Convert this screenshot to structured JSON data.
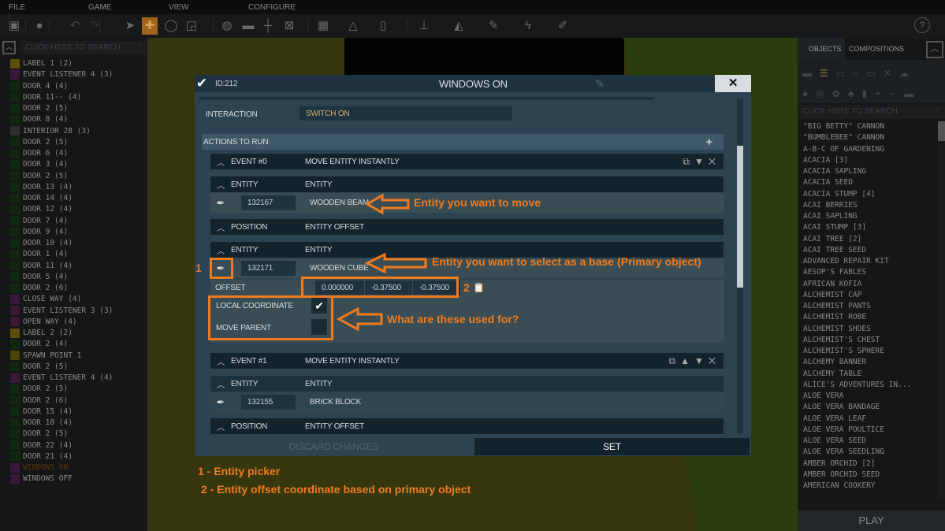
{
  "menubar": [
    "FILE",
    "GAME",
    "VIEW",
    "CONFIGURE"
  ],
  "left_panel": {
    "search_placeholder": "CLICK HERE TO SEARCH",
    "items": [
      {
        "label": "LABEL 1 (2)",
        "color": "#5a5008"
      },
      {
        "label": "EVENT LISTENER 4 (3)",
        "color": "#3a1838"
      },
      {
        "label": "DOOR 4 (4)",
        "color": "#10280f"
      },
      {
        "label": "DOOR 11-- (4)",
        "color": "#10280f"
      },
      {
        "label": "DOOR 2 (5)",
        "color": "#10280f"
      },
      {
        "label": "DOOR 8 (4)",
        "color": "#10280f"
      },
      {
        "label": "INTERIOR 28 (3)",
        "color": "#2e2e2e"
      },
      {
        "label": "DOOR 2 (5)",
        "color": "#10280f"
      },
      {
        "label": "DOOR 6 (4)",
        "color": "#10280f"
      },
      {
        "label": "DOOR 3 (4)",
        "color": "#10280f"
      },
      {
        "label": "DOOR 2 (5)",
        "color": "#10280f"
      },
      {
        "label": "DOOR 13 (4)",
        "color": "#10280f"
      },
      {
        "label": "DOOR 14 (4)",
        "color": "#10280f"
      },
      {
        "label": "DOOR 12 (4)",
        "color": "#10280f"
      },
      {
        "label": "DOOR 7 (4)",
        "color": "#10280f"
      },
      {
        "label": "DOOR 9 (4)",
        "color": "#10280f"
      },
      {
        "label": "DOOR 10 (4)",
        "color": "#10280f"
      },
      {
        "label": "DOOR 1 (4)",
        "color": "#10280f"
      },
      {
        "label": "DOOR 11 (4)",
        "color": "#10280f"
      },
      {
        "label": "DOOR 5 (4)",
        "color": "#10280f"
      },
      {
        "label": "DOOR 2 (6)",
        "color": "#10280f"
      },
      {
        "label": "CLOSE WAY (4)",
        "color": "#3a1838"
      },
      {
        "label": "EVENT LISTENER 3 (3)",
        "color": "#3a1838"
      },
      {
        "label": "OPEN WAY (4)",
        "color": "#3a1838"
      },
      {
        "label": "LABEL 2 (2)",
        "color": "#5a5008"
      },
      {
        "label": "DOOR 2 (4)",
        "color": "#10280f"
      },
      {
        "label": "SPAWN POINT 1",
        "color": "#4a4408"
      },
      {
        "label": "DOOR 2 (5)",
        "color": "#10280f"
      },
      {
        "label": "EVENT LISTENER 4 (4)",
        "color": "#3a1838"
      },
      {
        "label": "DOOR 2 (5)",
        "color": "#10280f"
      },
      {
        "label": "DOOR 2 (6)",
        "color": "#10280f"
      },
      {
        "label": "DOOR 15 (4)",
        "color": "#10280f"
      },
      {
        "label": "DOOR 18 (4)",
        "color": "#10280f"
      },
      {
        "label": "DOOR 2 (5)",
        "color": "#10280f"
      },
      {
        "label": "DOOR 22 (4)",
        "color": "#10280f"
      },
      {
        "label": "DOOR 21 (4)",
        "color": "#10280f"
      },
      {
        "label": "WINDOWS ON",
        "color": "#3a1838",
        "selected": true
      },
      {
        "label": "WINDOWS OFF",
        "color": "#3a1838"
      }
    ]
  },
  "right_panel": {
    "tabs": [
      "OBJECTS",
      "COMPOSITIONS"
    ],
    "search_placeholder": "CLICK HERE TO SEARCH",
    "items": [
      "\"BIG BETTY\" CANNON",
      "\"BUMBLEBEE\" CANNON",
      "A-B-C OF GARDENING",
      "ACACIA [3]",
      "ACACIA SAPLING",
      "ACACIA SEED",
      "ACACIA STUMP [4]",
      "ACAI BERRIES",
      "ACAI SAPLING",
      "ACAI STUMP [3]",
      "ACAI TREE [2]",
      "ACAI TREE SEED",
      "ADVANCED REPAIR KIT",
      "AESOP'S FABLES",
      "AFRICAN KOFIA",
      "ALCHEMIST CAP",
      "ALCHEMIST PANTS",
      "ALCHEMIST ROBE",
      "ALCHEMIST SHOES",
      "ALCHEMIST'S CHEST",
      "ALCHEMIST'S SPHERE",
      "ALCHEMY BANNER",
      "ALCHEMY TABLE",
      "ALICE'S ADVENTURES IN...",
      "ALOE VERA",
      "ALOE VERA BANDAGE",
      "ALOE VERA LEAF",
      "ALOE VERA POULTICE",
      "ALOE VERA SEED",
      "ALOE VERA SEEDLING",
      "AMBER ORCHID [2]",
      "AMBER ORCHID SEED",
      "AMERICAN COOKERY"
    ],
    "play_label": "PLAY"
  },
  "dialog": {
    "id": "ID:212",
    "title": "WINDOWS ON",
    "interaction_label": "INTERACTION",
    "interaction_value": "SWITCH ON",
    "actions_label": "ACTIONS TO RUN",
    "event0": {
      "label": "EVENT #0",
      "action": "MOVE ENTITY INSTANTLY",
      "entity_label": "ENTITY",
      "entity_type": "ENTITY",
      "entity_id": "132167",
      "entity_name": "WOODEN BEAM",
      "position_label": "POSITION",
      "position_type": "ENTITY OFFSET",
      "base_label": "ENTITY",
      "base_type": "ENTITY",
      "base_id": "132171",
      "base_name": "WOODEN CUBE",
      "offset_label": "OFFSET",
      "offset": [
        "0.000000",
        "-0.37500",
        "-0.37500"
      ],
      "local_coordinate_label": "LOCAL COORDINATE",
      "local_coordinate": true,
      "move_parent_label": "MOVE PARENT",
      "move_parent": false
    },
    "event1": {
      "label": "EVENT #1",
      "action": "MOVE ENTITY INSTANTLY",
      "entity_label": "ENTITY",
      "entity_type": "ENTITY",
      "entity_id": "132155",
      "entity_name": "BRICK BLOCK",
      "position_label": "POSITION",
      "position_type": "ENTITY OFFSET"
    },
    "discard_label": "DISCARD CHANGES",
    "set_label": "SET"
  },
  "annotations": {
    "move": "Entity you want to move",
    "base": "Entity you want to select as a base (Primary object)",
    "question": "What are these used for?",
    "num1": "1",
    "num2": "2",
    "legend1": "1 - Entity picker",
    "legend2": "2 - Entity offset coordinate based on primary object",
    "color": "#f07b1e"
  }
}
